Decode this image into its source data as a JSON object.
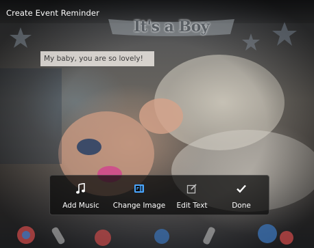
{
  "screen": {
    "title": "Create Event Reminder",
    "banner": "It's a Boy",
    "caption": "My baby, you are so lovely!"
  },
  "toolbar": {
    "items": [
      {
        "label": "Add Music",
        "icon": "music-note-icon",
        "highlighted": false
      },
      {
        "label": "Change Image",
        "icon": "change-image-icon",
        "highlighted": true
      },
      {
        "label": "Edit Text",
        "icon": "edit-text-icon",
        "highlighted": false
      },
      {
        "label": "Done",
        "icon": "checkmark-icon",
        "highlighted": false
      }
    ]
  },
  "colors": {
    "highlight_icon": "#4aa6ff",
    "toolbar_bg": "#0a0a0a",
    "caption_bg": "#f0ebe6"
  }
}
